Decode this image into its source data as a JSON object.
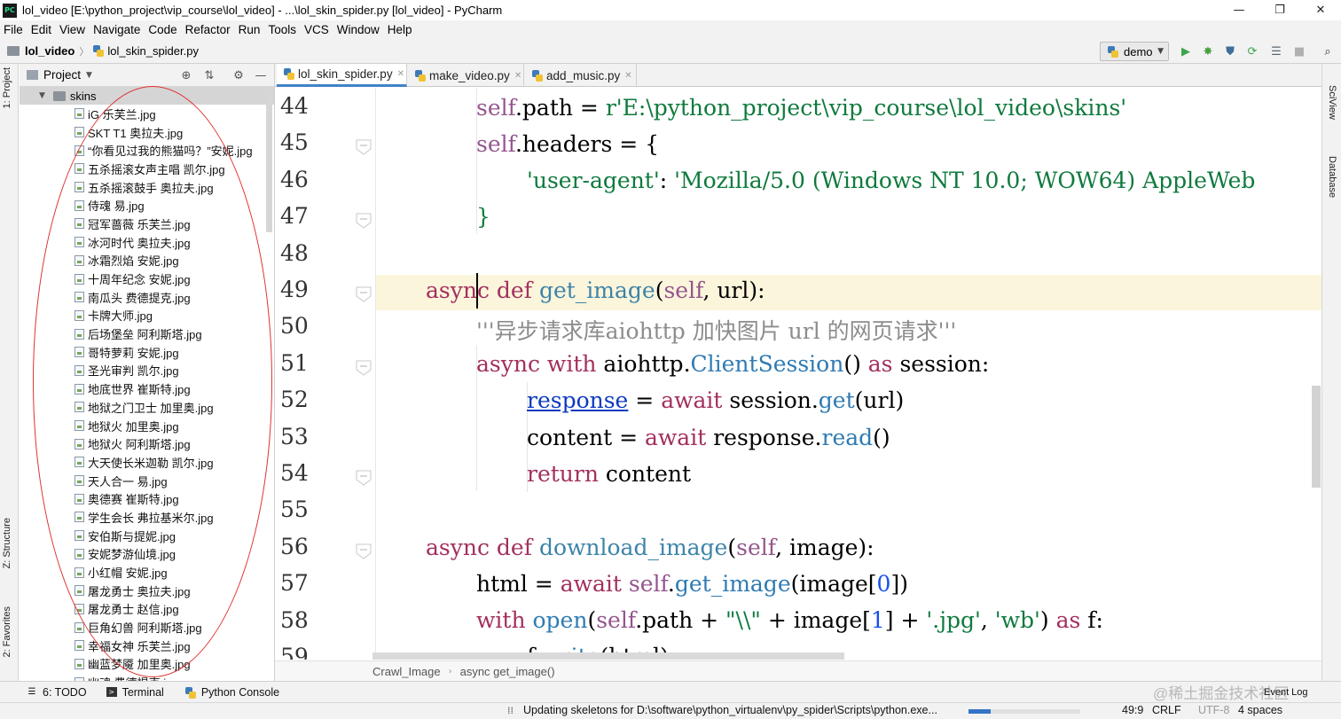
{
  "window": {
    "title": "lol_video [E:\\python_project\\vip_course\\lol_video] - ...\\lol_skin_spider.py [lol_video] - PyCharm",
    "app_icon_text": "PC",
    "controls": {
      "minimize": "—",
      "restore": "❐",
      "close": "✕"
    }
  },
  "menu": [
    "File",
    "Edit",
    "View",
    "Navigate",
    "Code",
    "Refactor",
    "Run",
    "Tools",
    "VCS",
    "Window",
    "Help"
  ],
  "breadcrumb_top": {
    "project": "lol_video",
    "file": "lol_skin_spider.py"
  },
  "run_config": {
    "name": "demo"
  },
  "toolbar_icons": [
    "run-icon",
    "debug-icon",
    "coverage-icon",
    "profile-icon",
    "concurrency-icon",
    "stop-icon",
    "search-icon"
  ],
  "left_tool_tabs": {
    "project": "1: Project",
    "structure": "Z: Structure",
    "favorites": "2: Favorites"
  },
  "right_tool_tabs": {
    "sciview": "SciView",
    "database": "Database"
  },
  "project_panel": {
    "title": "Project",
    "root_folder": "skins",
    "files": [
      "iG 乐芙兰.jpg",
      "SKT T1 奥拉夫.jpg",
      "“你看见过我的熊猫吗？”安妮.jpg",
      "五杀摇滚女声主唱 凯尔.jpg",
      "五杀摇滚鼓手 奥拉夫.jpg",
      "侍魂 易.jpg",
      "冠军蔷薇 乐芙兰.jpg",
      "冰河时代 奥拉夫.jpg",
      "冰霜烈焰 安妮.jpg",
      "十周年纪念 安妮.jpg",
      "南瓜头 费德提克.jpg",
      "卡牌大师.jpg",
      "后场堡垒 阿利斯塔.jpg",
      "哥特萝莉 安妮.jpg",
      "圣光审判 凯尔.jpg",
      "地底世界 崔斯特.jpg",
      "地狱之门卫士 加里奥.jpg",
      "地狱火 加里奥.jpg",
      "地狱火 阿利斯塔.jpg",
      "大天使长米迦勒 凯尔.jpg",
      "天人合一 易.jpg",
      "奥德赛 崔斯特.jpg",
      "学生会长 弗拉基米尔.jpg",
      "安伯斯与提妮.jpg",
      "安妮梦游仙境.jpg",
      "小红帽 安妮.jpg",
      "屠龙勇士 奥拉夫.jpg",
      "屠龙勇士 赵信.jpg",
      "巨角幻兽 阿利斯塔.jpg",
      "幸福女神 乐芙兰.jpg",
      "幽蓝梦魇 加里奥.jpg",
      "幽魂 费德提克.jpg"
    ]
  },
  "tabs": [
    {
      "label": "lol_skin_spider.py",
      "active": true
    },
    {
      "label": "make_video.py",
      "active": false
    },
    {
      "label": "add_music.py",
      "active": false
    }
  ],
  "editor": {
    "current_line": 49,
    "lines": [
      {
        "n": "44"
      },
      {
        "n": "45"
      },
      {
        "n": "46"
      },
      {
        "n": "47"
      },
      {
        "n": "48"
      },
      {
        "n": "49"
      },
      {
        "n": "50"
      },
      {
        "n": "51"
      },
      {
        "n": "52"
      },
      {
        "n": "53"
      },
      {
        "n": "54"
      },
      {
        "n": "55"
      },
      {
        "n": "56"
      },
      {
        "n": "57"
      },
      {
        "n": "58"
      },
      {
        "n": "59"
      }
    ],
    "tokens": {
      "l44": [
        "self",
        ".path = ",
        "r'E:\\python_project\\vip_course\\lol_video\\skins'"
      ],
      "l45": [
        "self",
        ".headers = {"
      ],
      "l46": [
        "'user-agent'",
        ": ",
        "'Mozilla/5.0 (Windows NT 10.0; WOW64) AppleWeb"
      ],
      "l47": [
        "}"
      ],
      "l49": [
        "async",
        " ",
        "def",
        " ",
        "get_image",
        "(",
        "self",
        ", url):"
      ],
      "l50": [
        "'''异步请求库aiohttp 加快图片 url 的网页请求'''"
      ],
      "l51": [
        "async",
        " ",
        "with",
        " aiohttp.",
        "ClientSession",
        "() ",
        "as",
        " session:"
      ],
      "l52": [
        "response",
        " = ",
        "await",
        " session.",
        "get",
        "(url)"
      ],
      "l53": [
        "content = ",
        "await",
        " response.",
        "read",
        "()"
      ],
      "l54": [
        "return",
        " content"
      ],
      "l56": [
        "async",
        " ",
        "def",
        " ",
        "download_image",
        "(",
        "self",
        ", image):"
      ],
      "l57": [
        "html = ",
        "await",
        " ",
        "self",
        ".",
        "get_image",
        "(image[",
        "0",
        "])"
      ],
      "l58": [
        "with",
        " ",
        "open",
        "(",
        "self",
        ".path + ",
        "\"\\\\\"",
        " + image[",
        "1",
        "] + ",
        "'.jpg'",
        ", ",
        "'wb'",
        ") ",
        "as",
        " f:"
      ],
      "l59": [
        "f.",
        "write",
        "(html)"
      ]
    }
  },
  "code_breadcrumb": {
    "class": "Crawl_Image",
    "method": "async get_image()"
  },
  "tool_windows": {
    "todo": "6: TODO",
    "terminal": "Terminal",
    "python_console": "Python Console",
    "event_log": "Event Log"
  },
  "status": {
    "message": "Updating skeletons for D:\\software\\python_virtualenv\\py_spider\\Scripts\\python.exe...",
    "progress": 0.2,
    "position": "49:9",
    "line_separator": "CRLF",
    "encoding": "UTF-8",
    "indent": "4 spaces"
  },
  "watermark": "@稀土掘金技术社区"
}
